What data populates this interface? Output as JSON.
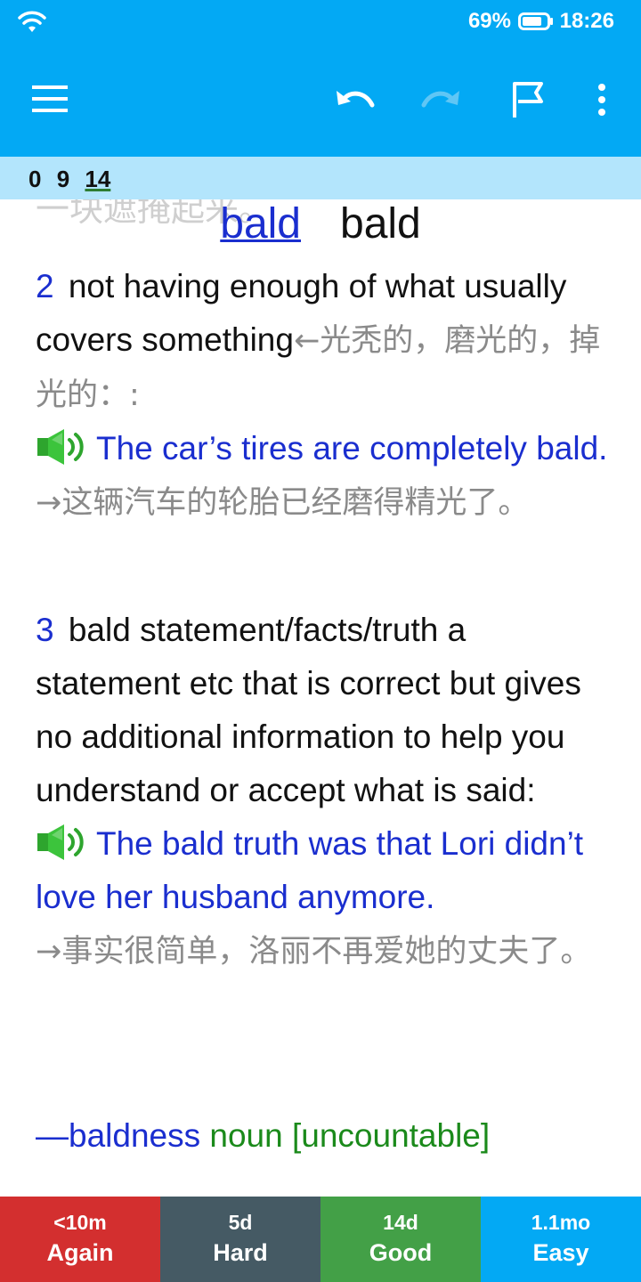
{
  "status_bar": {
    "battery_percent": "69%",
    "time": "18:26"
  },
  "toolbar": {
    "menu_icon": "hamburger-menu-icon",
    "undo_icon": "undo-icon",
    "redo_icon": "redo-icon",
    "flag_icon": "flag-icon",
    "more_icon": "more-vert-icon"
  },
  "counts": {
    "new": "0",
    "learning": "9",
    "review": "14"
  },
  "card": {
    "ghost_text": "一块遮掩起来。",
    "headword_link": "bald",
    "headword": "bald",
    "senses": [
      {
        "number": "2",
        "definition": "not having enough of what usually covers something",
        "translation": "←光秃的，磨光的，掉光的：:",
        "example": "The car’s tires are completely bald.",
        "example_translation": "→这辆汽车的轮胎已经磨得精光了。"
      },
      {
        "number": "3",
        "definition": "bald statement/facts/truth a statement etc that is correct but gives no additional information to help you understand or accept what is said:",
        "example": "The bald truth was that Lori didn’t love her husband anymore.",
        "example_translation": "→事实很简单，洛丽不再爱她的丈夫了。"
      }
    ],
    "derivative": {
      "word": "—baldness",
      "pos": "noun [uncountable]"
    }
  },
  "answers": [
    {
      "interval": "<10m",
      "label": "Again"
    },
    {
      "interval": "5d",
      "label": "Hard"
    },
    {
      "interval": "14d",
      "label": "Good"
    },
    {
      "interval": "1.1mo",
      "label": "Easy"
    }
  ],
  "colors": {
    "toolbar": "#03a9f4",
    "count_bar": "#b3e5fc",
    "again": "#d32f2f",
    "hard": "#455a64",
    "good": "#43a047",
    "easy": "#03a9f4",
    "example_text": "#1a2ecf",
    "translation_text": "#8a8a8a"
  }
}
